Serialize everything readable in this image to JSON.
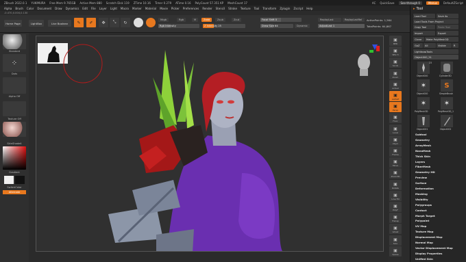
{
  "titlebar": {
    "app": "ZBrush 2022.0.1",
    "user": "YUKIMURA",
    "free_mem": "Free Mem 9.765GB",
    "active_mem": "Active Mem 880",
    "scratch": "Scratch Disk 119",
    "ztime": "ZTime 10.16",
    "timer": "Timer 0.279",
    "atime": "ATime 0.16",
    "polycount": "PolyCount 57.351 KP",
    "meshcount": "MeshCount 17",
    "ac": "AC",
    "quicksave": "QuickSave",
    "seethrough": "See-through 0",
    "menus_btn": "Menus",
    "default_script": "DefaultZScript"
  },
  "menubar": [
    "Alpha",
    "Brush",
    "Color",
    "Document",
    "Draw",
    "Dynamics",
    "Edit",
    "File",
    "Layer",
    "Light",
    "Macro",
    "Marker",
    "Material",
    "Movie",
    "Picker",
    "Preferences",
    "Render",
    "Stencil",
    "Stroke",
    "Texture",
    "Tool",
    "Transform",
    "Zplugin",
    "Zscript",
    "Help"
  ],
  "coords": "-0.470,0.004,0.130",
  "shelf": {
    "home_page": "Home Page",
    "lightbox": "LightBox",
    "live_boolean": "Live Boolean",
    "edit": "Edit",
    "draw": "Draw",
    "move": "Move",
    "scale": "Scale",
    "rotate": "Rotate",
    "mrgb": "Mrgb",
    "rgb": "Rgb",
    "m": "M",
    "zadd": "Zadd",
    "zsub": "Zsub",
    "zcut": "Zcut",
    "rgb_intensity": "Rgb Intensity",
    "z_intensity": "Z Intensity 25",
    "focal_shift": "Focal Shift 0",
    "draw_size": "Draw Size 64",
    "dynamic": "Dynamic",
    "replay_last": "ReplayLast",
    "replay_last_rel": "ReplayLastRel",
    "adjust_last": "AdjustLast 1",
    "active_points": "ActivePoints: 1,564",
    "total_points": "TotalPoints: 64,867"
  },
  "leftpanel": {
    "brush_name": "Standard",
    "stroke_name": "Dots",
    "alpha_name": "Alpha Off",
    "texture_name": "Texture Off",
    "material_name": "SkinShade4",
    "gradient": "Gradient",
    "switch_color": "SwitchColor",
    "alternate": "Alternate"
  },
  "rightdock": [
    "BPR",
    "SPix 3",
    "Scroll",
    "Zoom",
    "Actual",
    "AAHalf",
    "Persp",
    "Floor",
    "Local",
    "LSym",
    "Frame",
    "Move",
    "Zoom3D",
    "Rotate",
    "Line Fill",
    "PolyF",
    "Transp",
    "Ghost",
    "Solo",
    "Xpose"
  ],
  "toolpanel": {
    "title": "Tool",
    "load_tool": "Load Tool",
    "save_as": "Save As",
    "load_tools_from_project": "Load Tools From Project",
    "copy_tool": "Copy Tool",
    "paste_tool": "Paste Tool",
    "import": "Import",
    "export": "Export",
    "clone": "Clone",
    "make_polymesh": "Make PolyMesh3D",
    "goz": "GoZ",
    "all": "All",
    "visible": "Visible",
    "r": "R",
    "lightbox_tools": "Lightbox▸Tools",
    "object_slider": "Object000_51",
    "thumb_count": "23",
    "thumbs": [
      "Object000",
      "Cylinder3D",
      "Object000",
      "SimpleBrush",
      "PolyMesh3D",
      "PolyMesh3D_1",
      "Object001",
      "Object002"
    ],
    "sections": [
      "Subtool",
      "Geometry",
      "ArrayMesh",
      "NanoMesh",
      "Thick Skin",
      "Layers",
      "FiberMesh",
      "Geometry HD",
      "Preview",
      "Surface",
      "Deformation",
      "Masking",
      "Visibility",
      "Polygroups",
      "Contact",
      "Morph Target",
      "Polypaint",
      "UV Map",
      "Texture Map",
      "Displacement Map",
      "Normal Map",
      "Vector Displacement Map",
      "Display Properties",
      "Unified Skin"
    ]
  },
  "colors": {
    "accent": "#e8781e",
    "canvas_bg": "#303030",
    "panel": "#262626",
    "hair": "#b41e24",
    "outfit": "#6a2fb0"
  }
}
